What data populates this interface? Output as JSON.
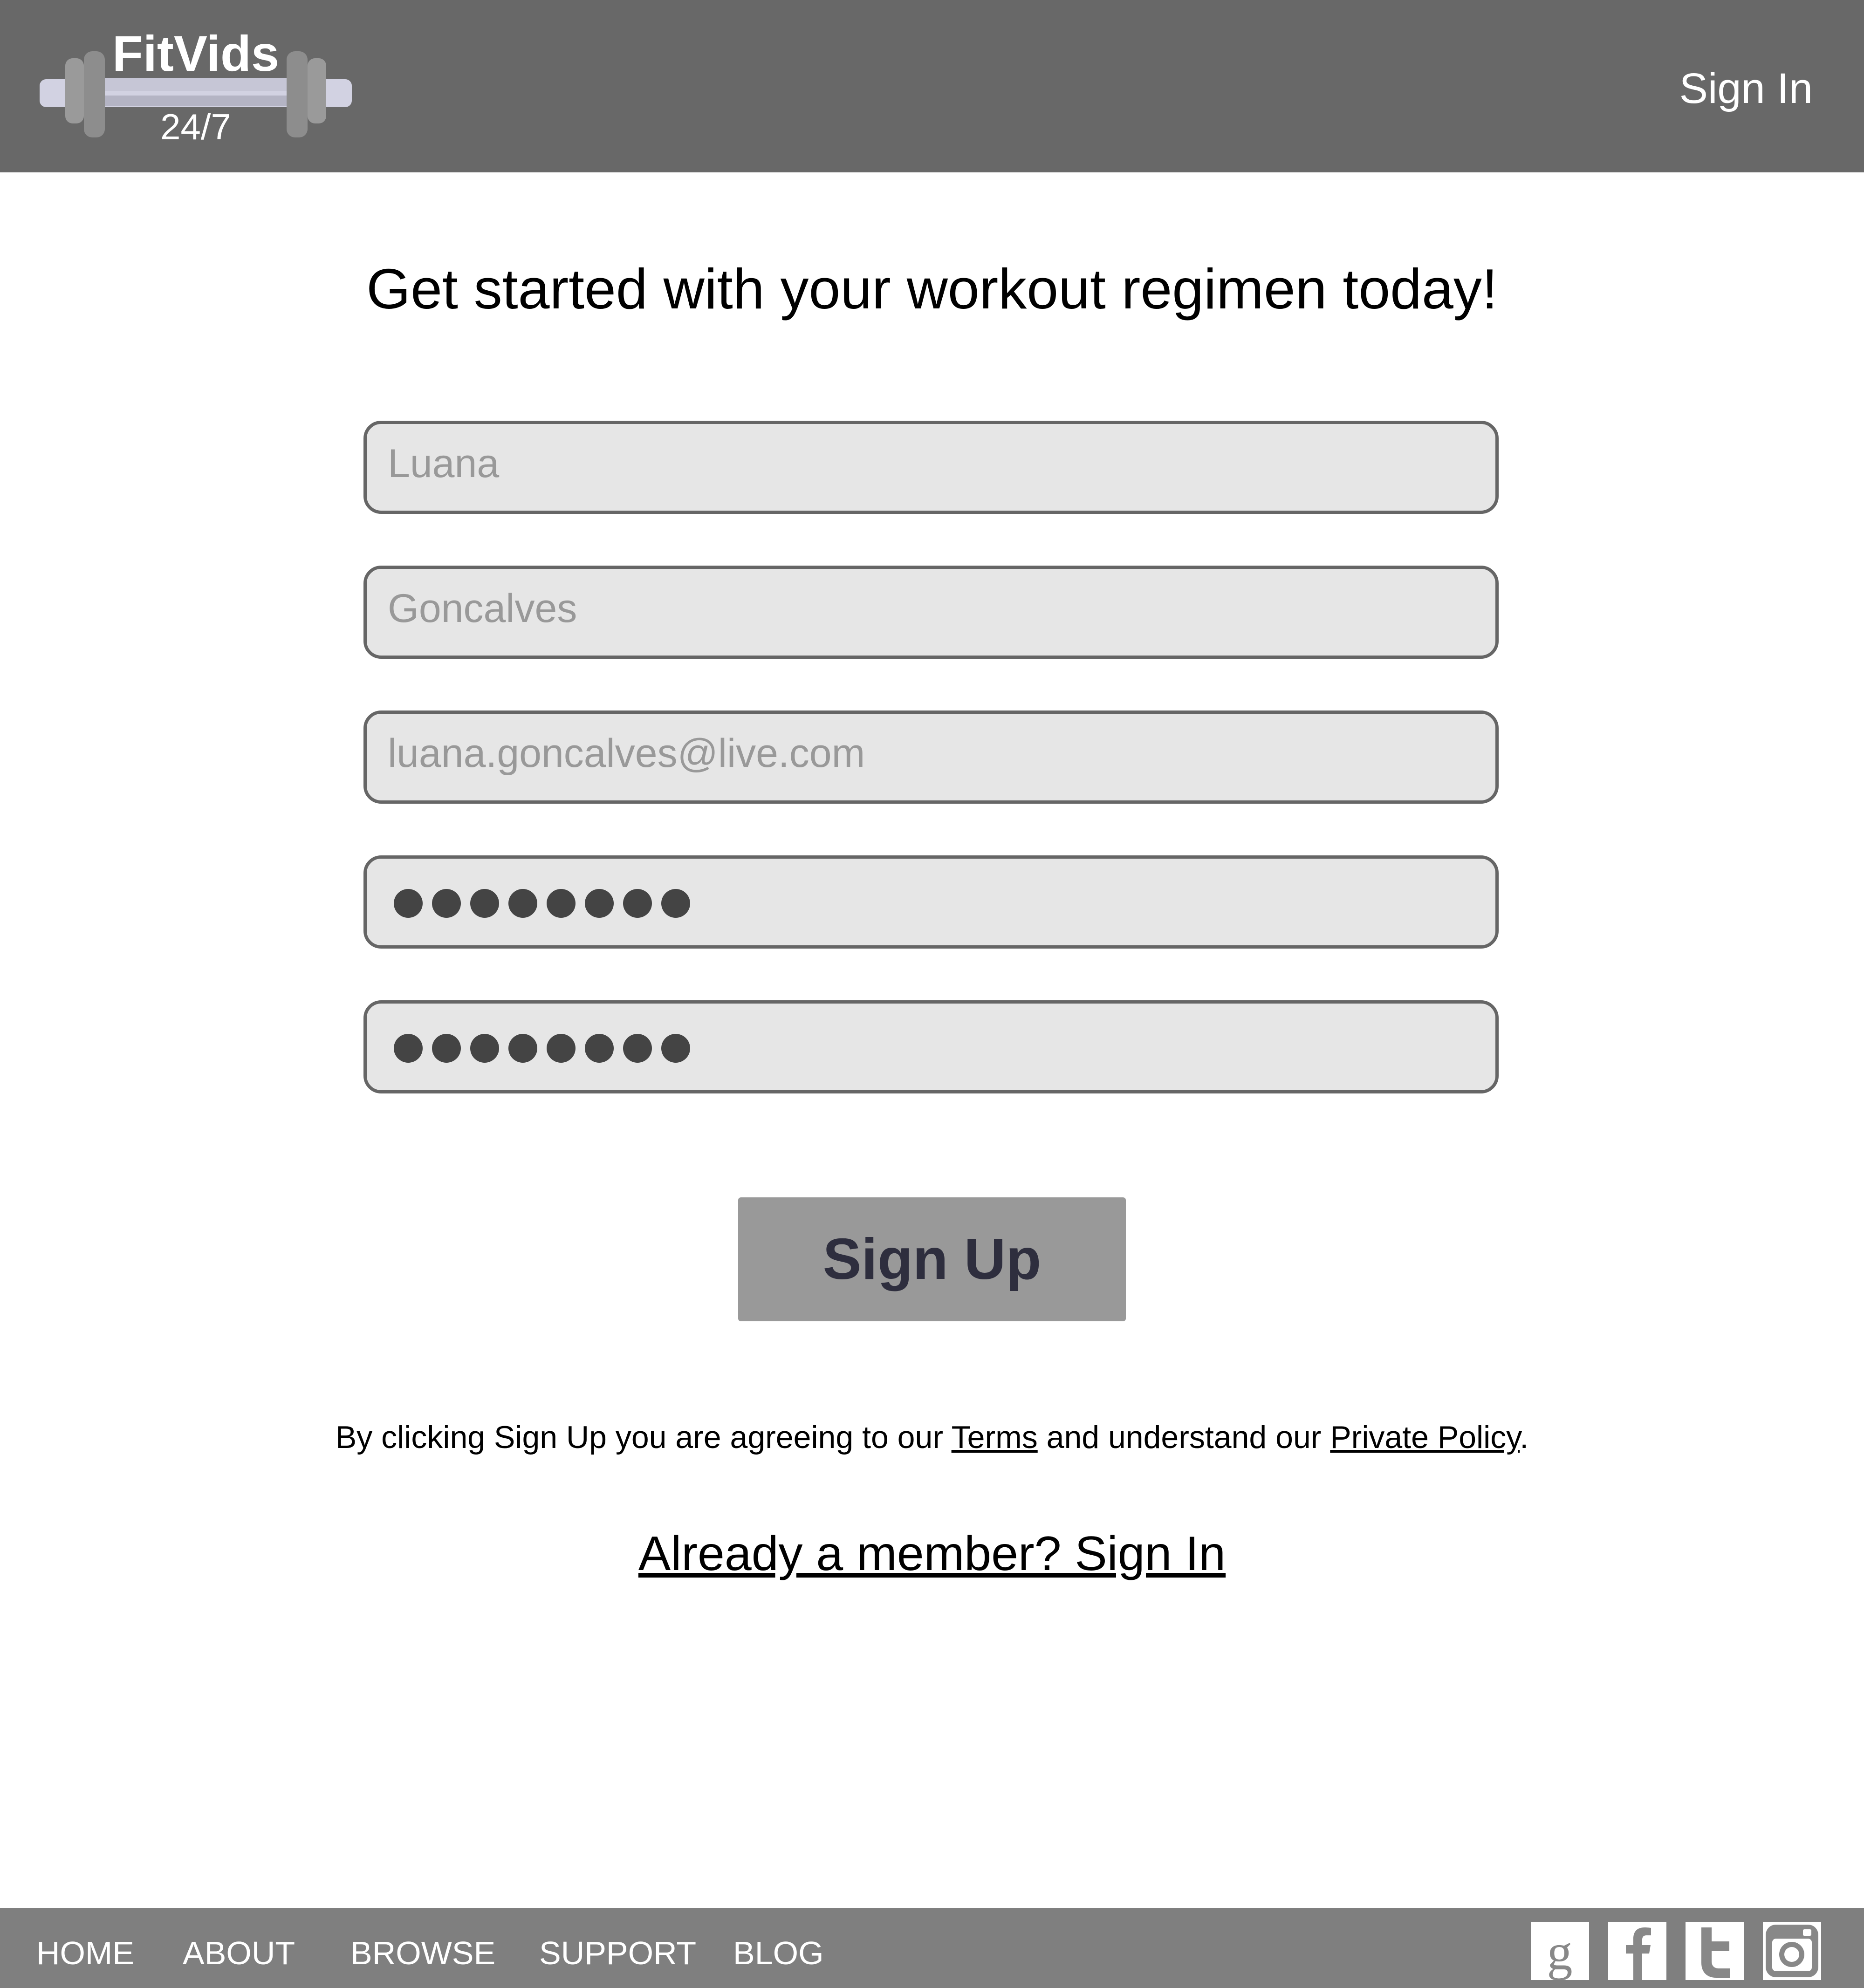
{
  "header": {
    "logo_title": "FitVids",
    "logo_subtitle": "24/7",
    "signin_label": "Sign In"
  },
  "main": {
    "headline": "Get started with your workout regimen today!",
    "fields": {
      "first_name": "Luana",
      "last_name": "Goncalves",
      "email": "luana.goncalves@live.com",
      "password_mask_count": 8,
      "confirm_password_mask_count": 8
    },
    "signup_label": "Sign Up",
    "terms": {
      "prefix": "By clicking Sign Up you are agreeing to our ",
      "terms_link": "Terms",
      "middle": " and understand our ",
      "policy_link": "Private Policy",
      "suffix": "."
    },
    "member_link": "Already a member? Sign In"
  },
  "footer": {
    "nav": [
      "HOME",
      "ABOUT",
      "BROWSE",
      "SUPPORT",
      "BLOG"
    ],
    "social_icons": [
      "google-icon",
      "facebook-icon",
      "twitter-icon",
      "instagram-icon"
    ]
  },
  "colors": {
    "header_bg": "#686868",
    "footer_bg": "#7f7f7f",
    "field_bg": "#e6e6e6",
    "button_bg": "#999999",
    "button_text": "#2e2e3e"
  }
}
